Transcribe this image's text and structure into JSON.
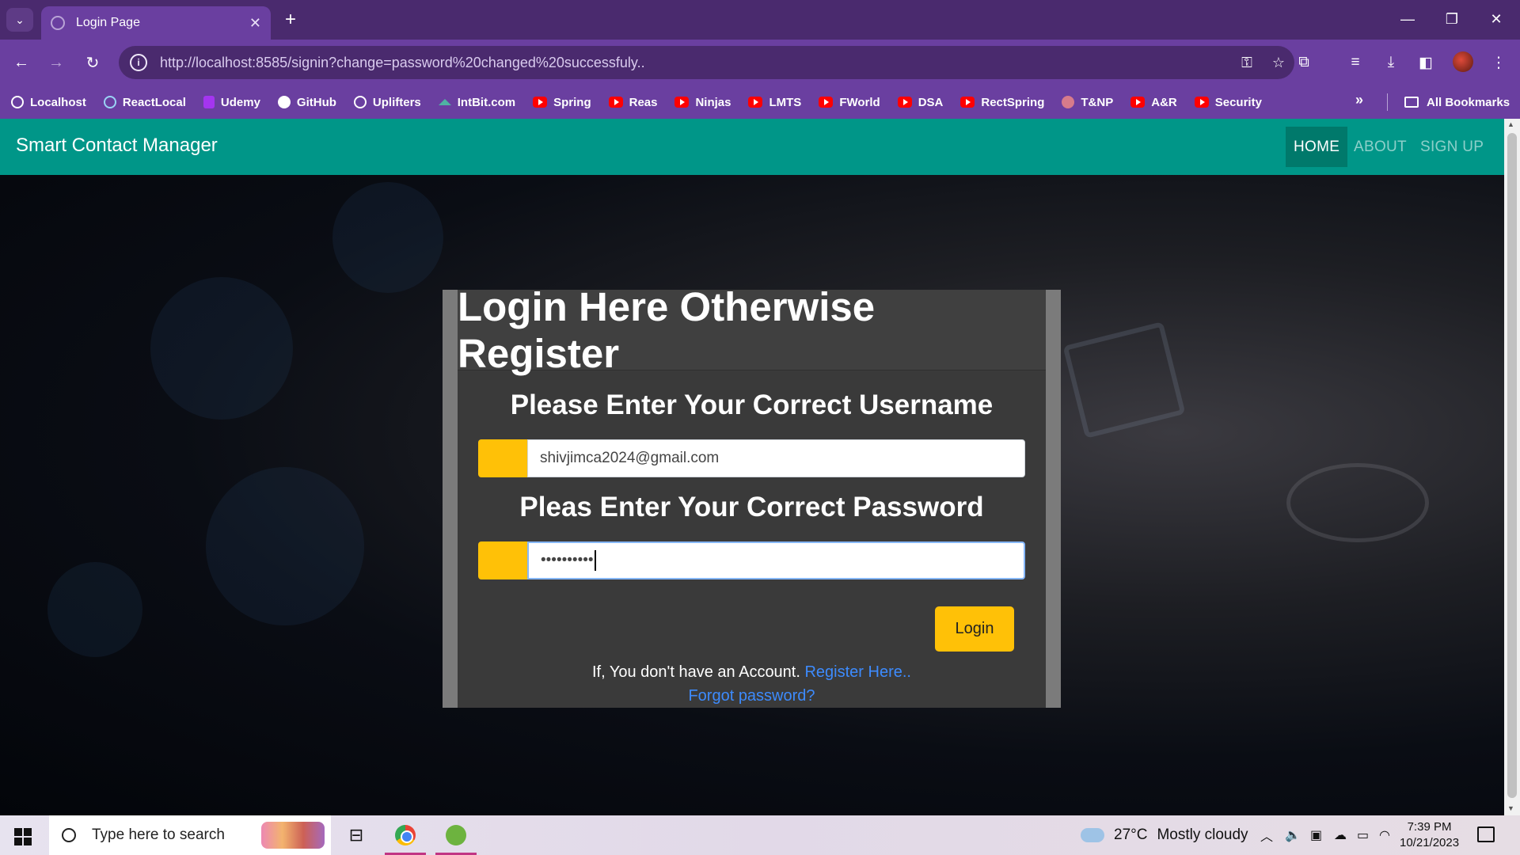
{
  "browser": {
    "tab_title": "Login Page",
    "url": "http://localhost:8585/signin?change=password%20changed%20successfuly..",
    "bookmarks": [
      {
        "label": "Localhost",
        "icon": "globe-icon"
      },
      {
        "label": "ReactLocal",
        "icon": "react-icon"
      },
      {
        "label": "Udemy",
        "icon": "udemy-icon"
      },
      {
        "label": "GitHub",
        "icon": "github-icon"
      },
      {
        "label": "Uplifters",
        "icon": "globe-icon"
      },
      {
        "label": "IntBit.com",
        "icon": "intbit-icon"
      },
      {
        "label": "Spring",
        "icon": "youtube-icon"
      },
      {
        "label": "Reas",
        "icon": "youtube-icon"
      },
      {
        "label": "Ninjas",
        "icon": "youtube-icon"
      },
      {
        "label": "LMTS",
        "icon": "youtube-icon"
      },
      {
        "label": "FWorld",
        "icon": "youtube-icon"
      },
      {
        "label": "DSA",
        "icon": "youtube-icon"
      },
      {
        "label": "RectSpring",
        "icon": "youtube-icon"
      },
      {
        "label": "T&NP",
        "icon": "tnp-icon"
      },
      {
        "label": "A&R",
        "icon": "youtube-icon"
      },
      {
        "label": "Security",
        "icon": "youtube-icon"
      }
    ],
    "more_bookmarks": "»",
    "all_bookmarks": "All Bookmarks",
    "theme_color": "#6a3fa0"
  },
  "navbar": {
    "brand": "Smart Contact Manager",
    "items": [
      {
        "label": "HOME",
        "active": true
      },
      {
        "label": "ABOUT",
        "active": false
      },
      {
        "label": "SIGN UP",
        "active": false
      }
    ],
    "color": "#009688"
  },
  "login": {
    "title": "Login Here Otherwise Register",
    "username_label": "Please Enter Your Correct Username",
    "username_value": "shivjimca2024@gmail.com",
    "password_label": "Pleas Enter Your Correct Password",
    "password_value": "••••••••••",
    "button": "Login",
    "no_account_text": "If, You don't have an Account.",
    "register_link": "Register Here..",
    "forgot_link": "Forgot password?",
    "accent_color": "#ffc107"
  },
  "taskbar": {
    "search_placeholder": "Type here to search",
    "weather_temp": "27°C",
    "weather_desc": "Mostly cloudy",
    "time": "7:39 PM",
    "date": "10/21/2023"
  }
}
